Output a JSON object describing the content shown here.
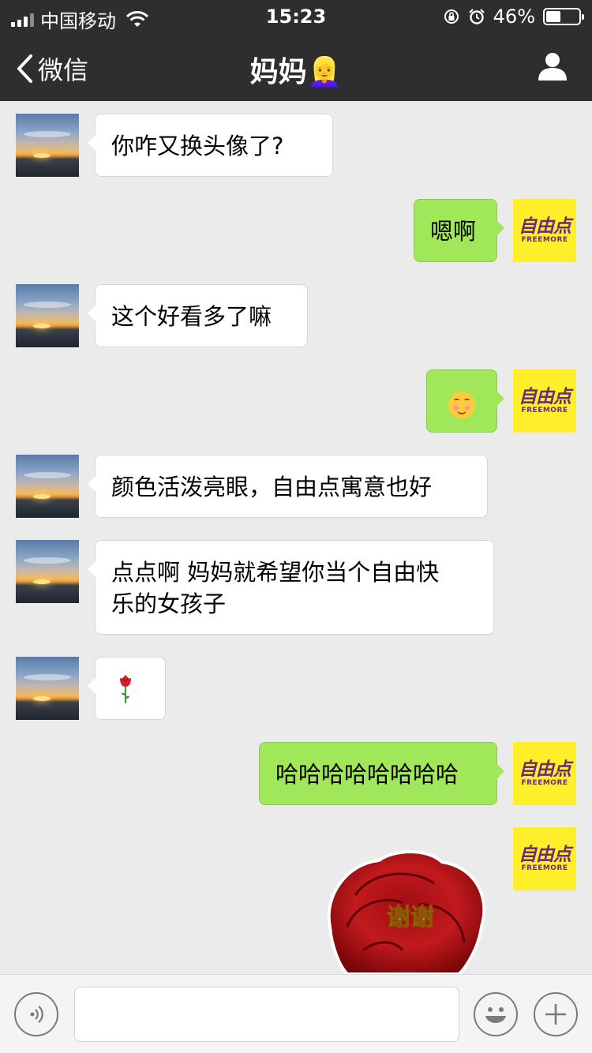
{
  "status_bar": {
    "carrier": "中国移动",
    "time": "15:23",
    "battery_percent": "46%",
    "battery_level": 0.46
  },
  "nav": {
    "back_label": "微信",
    "title": "妈妈",
    "title_emoji": "👱‍♀️"
  },
  "me_avatar": {
    "logo_text": "自由点",
    "logo_sub": "FREEMORE"
  },
  "messages": [
    {
      "side": "left",
      "text": "你咋又换头像了?"
    },
    {
      "side": "right",
      "text": "嗯啊"
    },
    {
      "side": "left",
      "text": "这个好看多了嘛"
    },
    {
      "side": "right",
      "type": "emoji",
      "icon": "blushing-smile-emoji"
    },
    {
      "side": "left",
      "text": "颜色活泼亮眼，自由点寓意也好"
    },
    {
      "side": "left",
      "text_line1": "点点啊 妈妈就希望你当个自由快",
      "text_line2": "乐的女孩子"
    },
    {
      "side": "left",
      "type": "emoji",
      "icon": "rose-emoji"
    },
    {
      "side": "right",
      "text": "哈哈哈哈哈哈哈哈"
    },
    {
      "side": "right",
      "type": "sticker",
      "icon": "rose-sticker",
      "text": "谢谢"
    }
  ],
  "colors": {
    "nav_bg": "#2e2e2e",
    "chat_bg": "#ebebeb",
    "bubble_me": "#a0e75a",
    "bubble_other": "#ffffff"
  }
}
